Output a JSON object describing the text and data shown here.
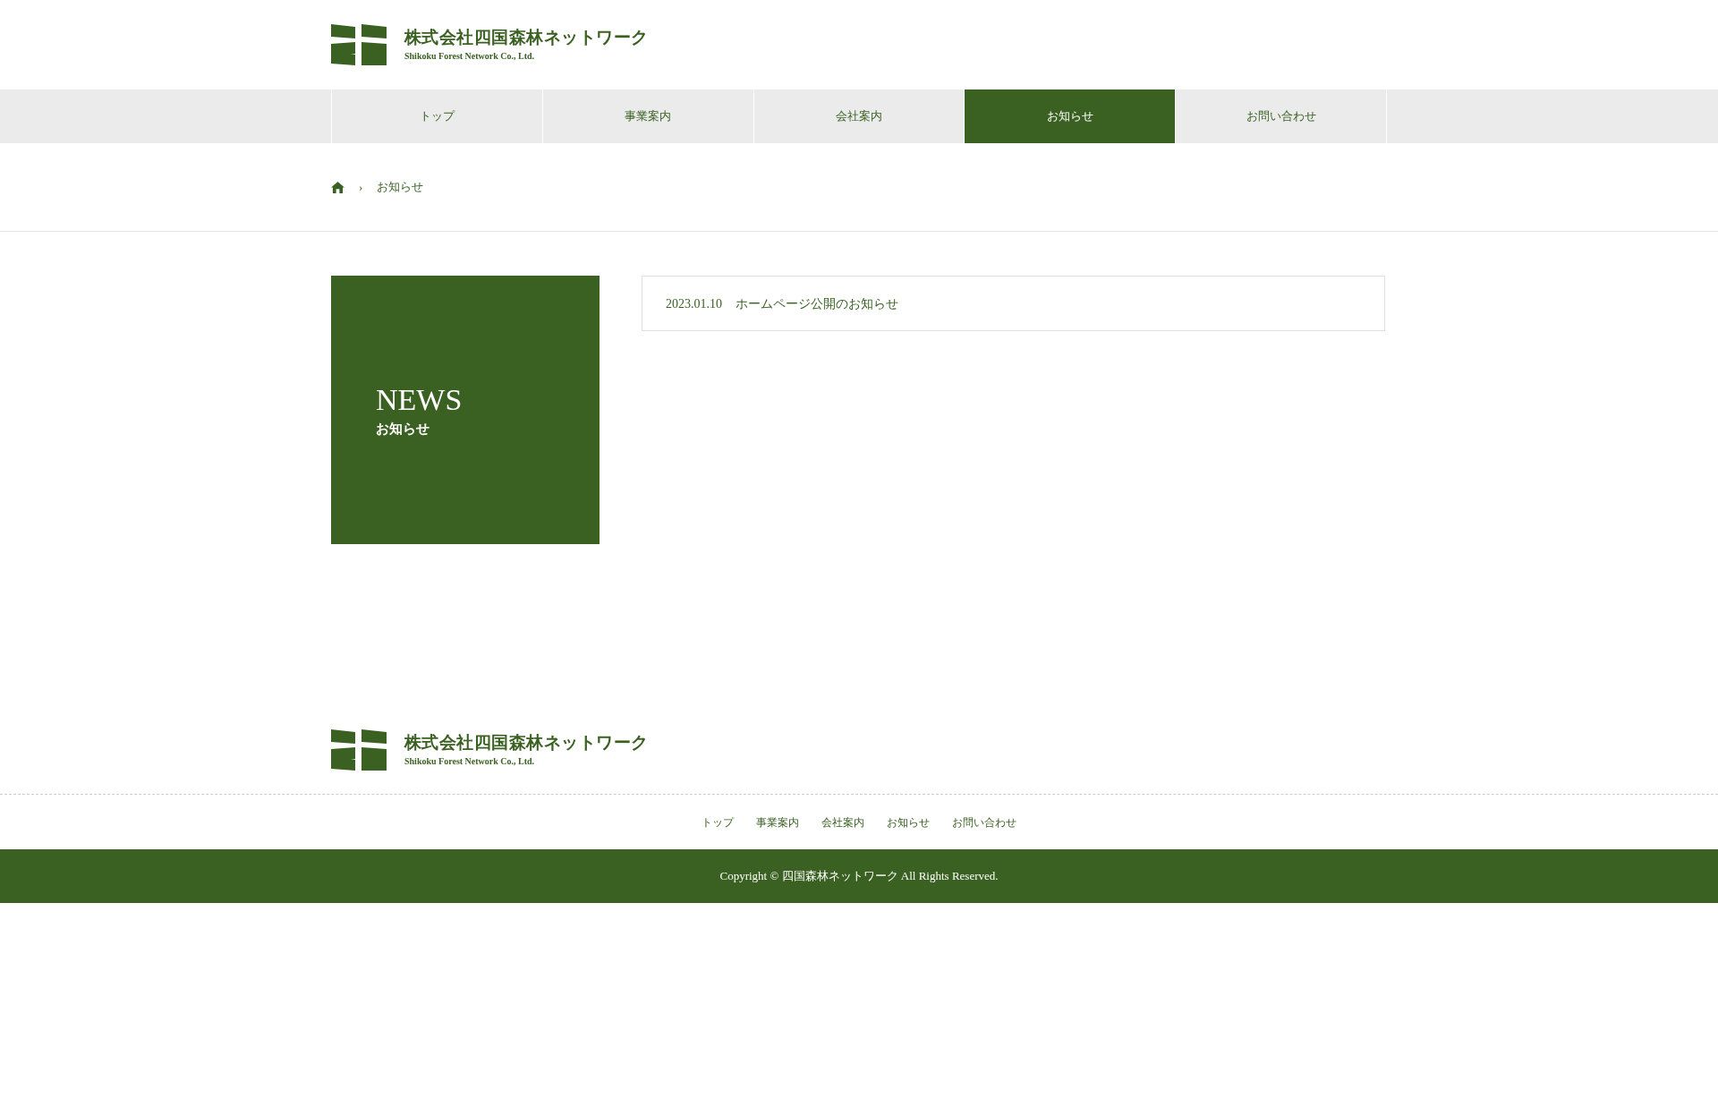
{
  "header": {
    "company": "株式会社四国森林ネットワーク",
    "company_en": "Shikoku Forest Network Co., Ltd."
  },
  "nav": [
    {
      "label": "トップ",
      "selected": false
    },
    {
      "label": "事業案内",
      "selected": false
    },
    {
      "label": "会社案内",
      "selected": false
    },
    {
      "label": "お知らせ",
      "selected": true
    },
    {
      "label": "お問い合わせ",
      "selected": false
    }
  ],
  "breadcrumb": {
    "separator": "›",
    "current": "お知らせ"
  },
  "page_title": {
    "title": "NEWS",
    "subtitle": "お知らせ"
  },
  "news": [
    {
      "date": "2023.01.10",
      "title": "ホームページ公開のお知らせ"
    }
  ],
  "footer": {
    "company": "株式会社四国森林ネットワーク",
    "company_en": "Shikoku Forest Network Co., Ltd.",
    "nav": [
      "トップ",
      "事業案内",
      "会社案内",
      "お知らせ",
      "お問い合わせ"
    ],
    "copyright": "Copyright © 四国森林ネットワーク All Rights Reserved."
  }
}
